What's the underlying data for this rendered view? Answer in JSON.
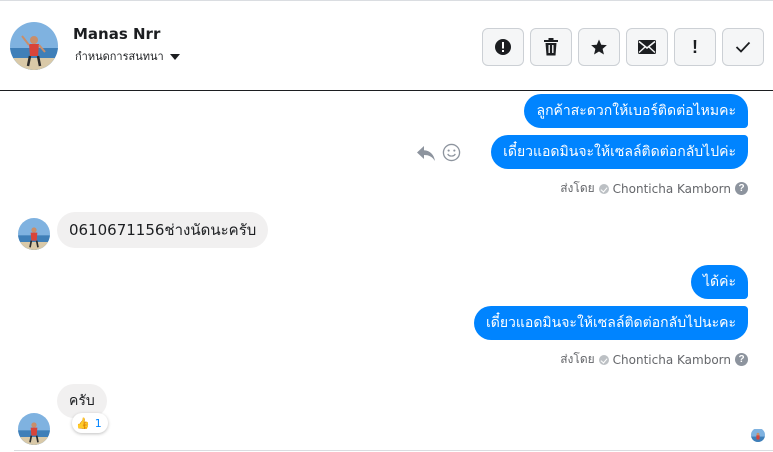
{
  "header": {
    "contact_name": "Manas Nrr",
    "subtitle": "กำหนดการสนทนา",
    "actions": [
      {
        "icon": "alert-circle-icon"
      },
      {
        "icon": "trash-icon"
      },
      {
        "icon": "star-icon"
      },
      {
        "icon": "envelope-icon"
      },
      {
        "icon": "exclamation-icon",
        "glyph": "!"
      },
      {
        "icon": "checkmark-icon"
      }
    ]
  },
  "messages": {
    "out_1": "ลูกค้าสะดวกให้เบอร์ติดต่อไหมคะ",
    "out_2": "เดี๋ยวแอดมินจะให้เซลล์ติดต่อกลับไปค่ะ",
    "sent_by_1": {
      "prefix": "ส่งโดย",
      "name": "Chonticha Kamborn",
      "help": "?"
    },
    "in_1": "0610671156ช่างนัดนะครับ",
    "out_3": "ได้ค่ะ",
    "out_4": "เดี๋ยวแอดมินจะให้เซลล์ติดต่อกลับไปนะคะ",
    "sent_by_2": {
      "prefix": "ส่งโดย",
      "name": "Chonticha Kamborn",
      "help": "?"
    },
    "in_2": "ครับ",
    "reaction": {
      "emoji": "👍",
      "count": "1"
    }
  },
  "colors": {
    "outgoing_bubble": "#0084ff",
    "incoming_bubble": "#f1f0f0"
  }
}
